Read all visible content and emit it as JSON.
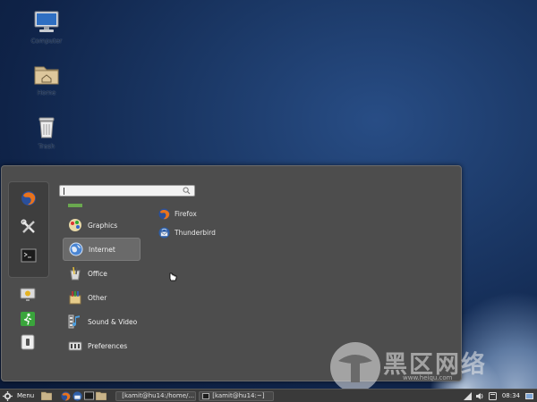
{
  "desktop": {
    "icons": [
      {
        "name": "Computer",
        "icon": "computer-icon"
      },
      {
        "name": "Home",
        "icon": "home-folder-icon"
      },
      {
        "name": "Trash",
        "icon": "trash-icon"
      }
    ]
  },
  "menu": {
    "search": {
      "placeholder": "",
      "value": ""
    },
    "favorites": [
      "firefox-icon",
      "settings-tools-icon",
      "terminal-icon"
    ],
    "system": [
      "screen-lock-icon",
      "logout-icon",
      "shutdown-icon"
    ],
    "categories": [
      {
        "label": "Graphics",
        "icon": "graphics-icon"
      },
      {
        "label": "Internet",
        "icon": "internet-globe-icon",
        "active": true
      },
      {
        "label": "Office",
        "icon": "office-icon"
      },
      {
        "label": "Other",
        "icon": "other-icon"
      },
      {
        "label": "Sound & Video",
        "icon": "sound-video-icon"
      },
      {
        "label": "Preferences",
        "icon": "preferences-icon"
      }
    ],
    "apps": [
      {
        "label": "Firefox",
        "icon": "firefox-icon"
      },
      {
        "label": "Thunderbird",
        "icon": "thunderbird-icon"
      }
    ]
  },
  "taskbar": {
    "menu_label": "Menu",
    "windows": [
      "[kamit@hu14:/home/...",
      "[kamit@hu14:~]"
    ],
    "clock": "08:34"
  },
  "watermark": {
    "text": "黑区网络",
    "url": "www.heiqu.com"
  },
  "colors": {
    "panel": "#4d4d4d",
    "accent_firefox": "#e8731d",
    "desktop": "#1b3866"
  }
}
